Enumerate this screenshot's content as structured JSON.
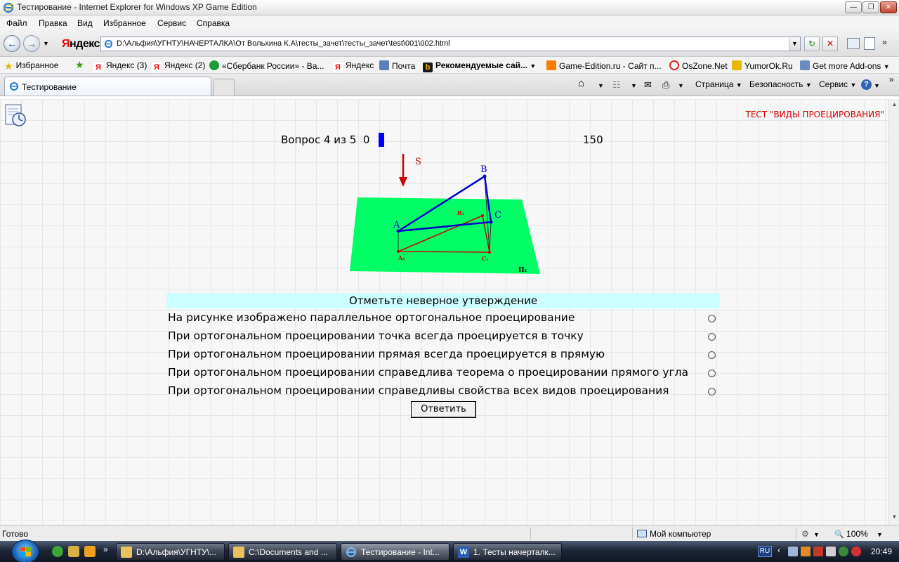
{
  "window": {
    "title": "Тестирование - Internet Explorer for Windows XP Game Edition"
  },
  "menu": [
    "Файл",
    "Правка",
    "Вид",
    "Избранное",
    "Сервис",
    "Справка"
  ],
  "address": {
    "search_brand": "Яндекс",
    "url": "D:\\Альфия\\УГНТУ\\НАЧЕРТАЛКА\\От Вольхина К.А\\тесты_зачет\\тесты_зачет\\test\\001\\002.html"
  },
  "favorites": {
    "label": "Избранное",
    "items": [
      "Яндекс (3)",
      "Яндекс (2)",
      "«Сбербанк России» - Ва...",
      "Яндекс",
      "Почта",
      "Рекомендуемые сай...",
      "Game-Edition.ru - Сайт п...",
      "OsZone.Net",
      "YumorOk.Ru",
      "Get more Add-ons"
    ]
  },
  "tab": {
    "label": "Тестирование"
  },
  "commands": [
    "Страница",
    "Безопасность",
    "Сервис"
  ],
  "test": {
    "title": "ТЕСТ \"ВИДЫ ПРОЕЦИРОВАНИЯ\"",
    "question_counter": "Вопрос 4 из 5",
    "correct_count": "0",
    "progress": 0.2,
    "score": "150",
    "figure_labels": {
      "direction": "S",
      "point_a": "A",
      "point_b": "B",
      "point_c": "C",
      "proj_a": "A₁",
      "proj_b": "B₁",
      "proj_c": "C₁",
      "plane": "П₁"
    },
    "prompt": "Отметьте неверное утверждение",
    "options": [
      "На рисунке изображено параллельное ортогональное проецирование",
      "При ортогональном проецировании точка всегда проецируется в точку",
      "При ортогональном проецировании прямая всегда проецируется в прямую",
      "При ортогональном проецировании справедлива теорема о проецировании прямого угла",
      "При ортогональном проецировании справедливы свойства всех видов проецирования"
    ],
    "submit_label": "Ответить"
  },
  "status": {
    "text": "Готово",
    "zone": "Мой компьютер",
    "zoom": "100%"
  },
  "taskbar": {
    "tasks": [
      "D:\\Альфия\\УГНТУ\\...",
      "C:\\Documents and ...",
      "Тестирование - Int...",
      "1. Тесты начерталк..."
    ],
    "lang": "RU",
    "clock": "20:49"
  },
  "colors": {
    "plane": "#00ff66",
    "object_lines": "#0000cc",
    "projection_lines": "#cc0000",
    "prompt_bg": "#ccffff",
    "test_title": "#d40000",
    "progress": "#0000ff"
  }
}
